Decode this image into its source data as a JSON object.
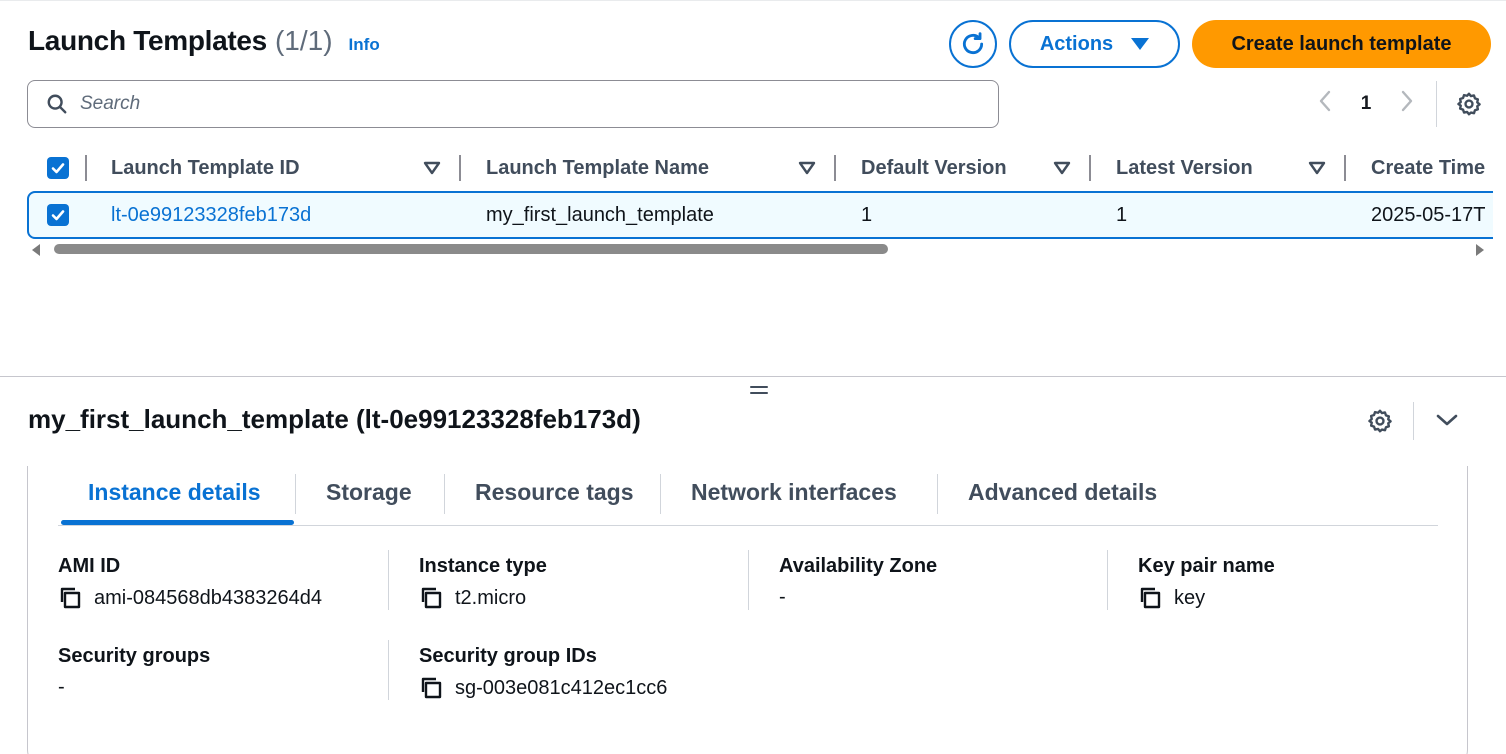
{
  "header": {
    "title": "Launch Templates",
    "count": "(1/1)",
    "info": "Info",
    "actions_label": "Actions",
    "create_label": "Create launch template"
  },
  "search": {
    "placeholder": "Search"
  },
  "pagination": {
    "current_page": "1"
  },
  "table": {
    "columns": [
      "Launch Template ID",
      "Launch Template Name",
      "Default Version",
      "Latest Version",
      "Create Time"
    ],
    "rows": [
      {
        "selected": true,
        "id": "lt-0e99123328feb173d",
        "name": "my_first_launch_template",
        "default_version": "1",
        "latest_version": "1",
        "create_time": "2025-05-17T"
      }
    ]
  },
  "detail": {
    "title": "my_first_launch_template (lt-0e99123328feb173d)",
    "tabs": [
      "Instance details",
      "Storage",
      "Resource tags",
      "Network interfaces",
      "Advanced details"
    ],
    "active_tab": "Instance details",
    "fields": {
      "ami_id": {
        "label": "AMI ID",
        "value": "ami-084568db4383264d4"
      },
      "instance_type": {
        "label": "Instance type",
        "value": "t2.micro"
      },
      "availability_zone": {
        "label": "Availability Zone",
        "value": "-"
      },
      "key_pair_name": {
        "label": "Key pair name",
        "value": "key"
      },
      "security_groups": {
        "label": "Security groups",
        "value": "-"
      },
      "security_group_ids": {
        "label": "Security group IDs",
        "value": "sg-003e081c412ec1cc6"
      }
    }
  },
  "colors": {
    "link_blue": "#0972d3",
    "primary_orange": "#ff9900",
    "text_dark": "#0f141a",
    "text_secondary": "#414d5c",
    "selected_row_bg": "#f0fbff"
  },
  "icons": [
    "refresh-icon",
    "caret-down-icon",
    "search-icon",
    "chevron-left-icon",
    "chevron-right-icon",
    "gear-icon",
    "sort-icon",
    "checkbox-checked-icon",
    "copy-icon",
    "drag-handle-icon",
    "chevron-down-icon"
  ]
}
